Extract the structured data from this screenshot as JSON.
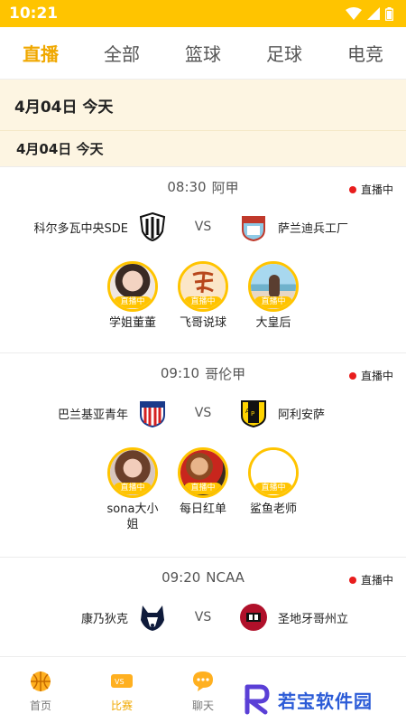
{
  "status": {
    "time": "10:21"
  },
  "tabs": [
    {
      "label": "直播",
      "active": true
    },
    {
      "label": "全部"
    },
    {
      "label": "篮球"
    },
    {
      "label": "足球"
    },
    {
      "label": "电竞"
    }
  ],
  "date_main": "4月04日  今天",
  "date_sub": "4月04日   今天",
  "matches": [
    {
      "time": "08:30",
      "league": "阿甲",
      "status": "直播中",
      "home": "科尔多瓦中央SDE",
      "vs": "VS",
      "away": "萨兰迪兵工厂",
      "hosts": [
        {
          "name": "学姐董董",
          "tag": "直播中"
        },
        {
          "name": "飞哥说球",
          "tag": "直播中"
        },
        {
          "name": "大皇后",
          "tag": "直播中"
        }
      ]
    },
    {
      "time": "09:10",
      "league": "哥伦甲",
      "status": "直播中",
      "home": "巴兰基亚青年",
      "vs": "VS",
      "away": "阿利安萨",
      "hosts": [
        {
          "name": "sona大小姐",
          "tag": "直播中"
        },
        {
          "name": "每日红单",
          "tag": "直播中"
        },
        {
          "name": "鲨鱼老师",
          "tag": "直播中"
        }
      ]
    },
    {
      "time": "09:20",
      "league": "NCAA",
      "status": "直播中",
      "home": "康乃狄克",
      "vs": "VS",
      "away": "圣地牙哥州立"
    }
  ],
  "nav": [
    {
      "label": "首页",
      "icon": "basketball-icon"
    },
    {
      "label": "比赛",
      "icon": "ticket-icon",
      "active": true
    },
    {
      "label": "聊天",
      "icon": "chat-icon"
    }
  ],
  "watermark": {
    "text": "若宝软件园"
  },
  "colors": {
    "accent": "#ffc400",
    "active_text": "#f0a800",
    "live_dot": "#e81d1d",
    "date_bg": "#fdf5e2"
  }
}
